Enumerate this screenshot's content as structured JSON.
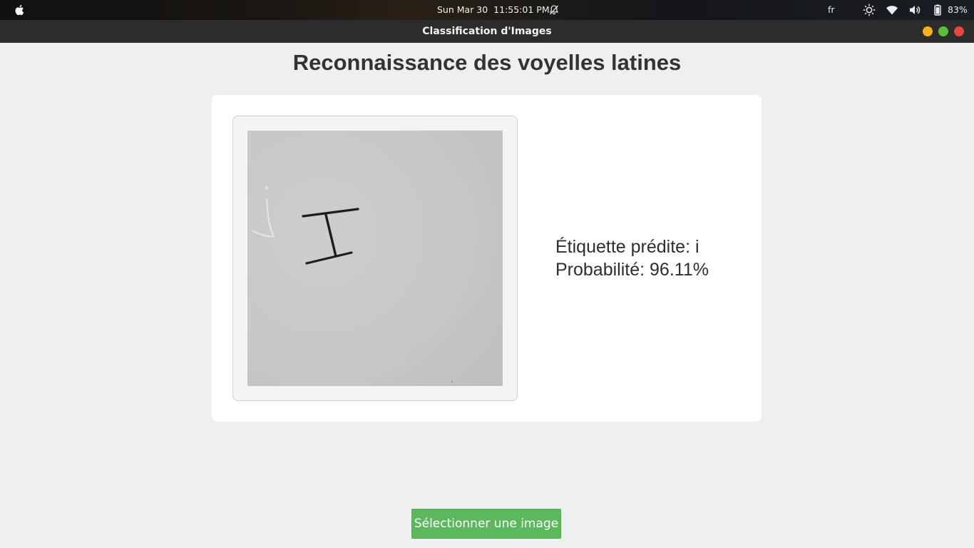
{
  "system_bar": {
    "clock": "Sun Mar 30  11:55:01 PM",
    "language": "fr",
    "battery_percent": "83%",
    "icons": [
      "apple-icon",
      "bell-muted-icon",
      "brightness-icon",
      "wifi-icon",
      "volume-icon",
      "battery-icon"
    ]
  },
  "window": {
    "title": "Classification d'Images",
    "controls": [
      "minimize",
      "maximize",
      "close"
    ]
  },
  "main": {
    "heading": "Reconnaissance des voyelles latines",
    "prediction_label": "Étiquette prédite: i",
    "probability_label": "Probabilité: 96.11%"
  },
  "actions": {
    "select_image_label": "Sélectionner une image"
  },
  "colors": {
    "accent_button": "#5cb85c",
    "background": "#efefef",
    "card": "#ffffff"
  }
}
